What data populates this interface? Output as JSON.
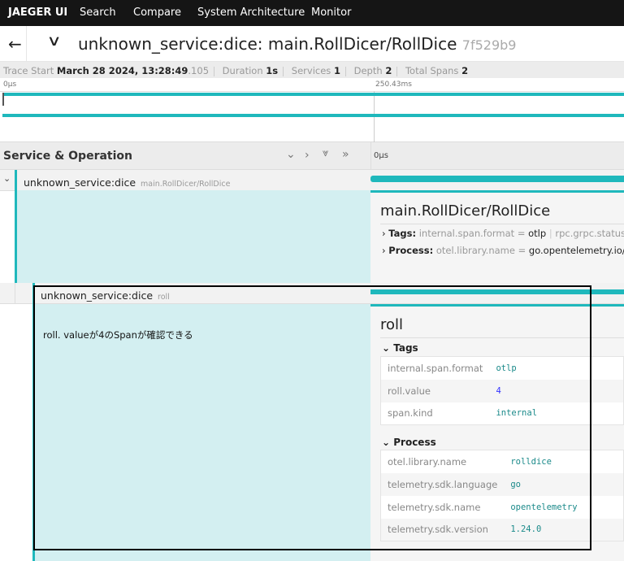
{
  "nav": {
    "brand": "JAEGER UI",
    "items": [
      "Search",
      "Compare",
      "System Architecture",
      "Monitor"
    ]
  },
  "header": {
    "title": "unknown_service:dice: main.RollDicer/RollDice",
    "trace_id": "7f529b9"
  },
  "summary": {
    "trace_start_label": "Trace Start",
    "trace_start": "March 28 2024, 13:28:49",
    "trace_start_ms": ".105",
    "duration_label": "Duration",
    "duration": "1s",
    "services_label": "Services",
    "services": "1",
    "depth_label": "Depth",
    "depth": "2",
    "total_spans_label": "Total Spans",
    "total_spans": "2"
  },
  "minimap": {
    "ticks": [
      "0µs",
      "250.43ms"
    ]
  },
  "columns": {
    "title": "Service & Operation",
    "timeline_tick": "0µs"
  },
  "spans": [
    {
      "service": "unknown_service:dice",
      "operation": "main.RollDicer/RollDice",
      "detail": {
        "title": "main.RollDicer/RollDice",
        "tags_label": "Tags:",
        "tags_summary": [
          {
            "key": "internal.span.format",
            "value": "otlp"
          },
          {
            "key": "rpc.grpc.status"
          }
        ],
        "process_label": "Process:",
        "process_summary": [
          {
            "key": "otel.library.name",
            "value": "go.opentelemetry.io/c"
          }
        ]
      }
    },
    {
      "service": "unknown_service:dice",
      "operation": "roll",
      "detail": {
        "title": "roll",
        "tags_label": "Tags",
        "tags": [
          {
            "key": "internal.span.format",
            "value": "otlp"
          },
          {
            "key": "roll.value",
            "value": "4"
          },
          {
            "key": "span.kind",
            "value": "internal"
          }
        ],
        "process_label": "Process",
        "process": [
          {
            "key": "otel.library.name",
            "value": "rolldice"
          },
          {
            "key": "telemetry.sdk.language",
            "value": "go"
          },
          {
            "key": "telemetry.sdk.name",
            "value": "opentelemetry"
          },
          {
            "key": "telemetry.sdk.version",
            "value": "1.24.0"
          }
        ]
      }
    }
  ],
  "annotation": "roll. valueが4のSpanが確認できる",
  "colors": {
    "accent": "#1fb8bc",
    "detail_bg": "#d3eff1",
    "nav_bg": "#151515"
  }
}
